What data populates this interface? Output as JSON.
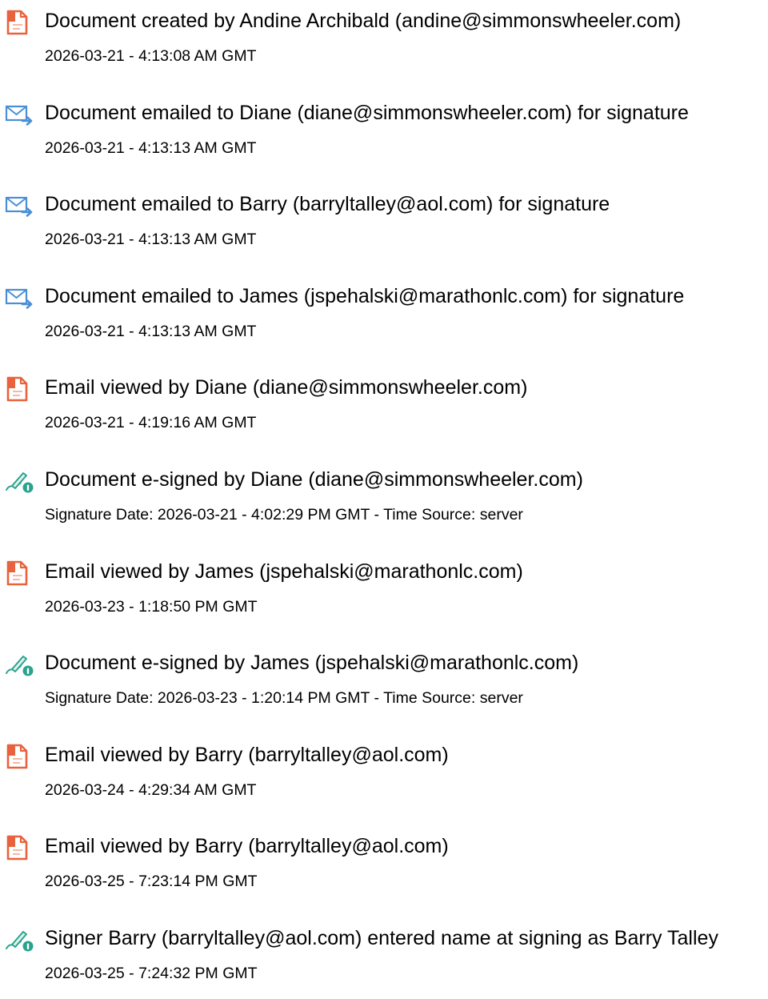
{
  "colors": {
    "document_icon": "#e8623d",
    "email_icon": "#4a8fd6",
    "signature_icon": "#2aa38e",
    "text": "#000000"
  },
  "events": [
    {
      "icon": "document-icon",
      "title": "Document created by Andine Archibald (andine@simmonswheeler.com)",
      "meta": "2026-03-21 - 4:13:08 AM GMT"
    },
    {
      "icon": "email-send-icon",
      "title": "Document emailed to Diane (diane@simmonswheeler.com) for signature",
      "meta": "2026-03-21 - 4:13:13 AM GMT"
    },
    {
      "icon": "email-send-icon",
      "title": "Document emailed to Barry (barryltalley@aol.com) for signature",
      "meta": "2026-03-21 - 4:13:13 AM GMT"
    },
    {
      "icon": "email-send-icon",
      "title": "Document emailed to James (jspehalski@marathonlc.com) for signature",
      "meta": "2026-03-21 - 4:13:13 AM GMT"
    },
    {
      "icon": "document-icon",
      "title": "Email viewed by Diane (diane@simmonswheeler.com)",
      "meta": "2026-03-21 - 4:19:16 AM GMT"
    },
    {
      "icon": "signature-pen-icon",
      "title": "Document e-signed by Diane (diane@simmonswheeler.com)",
      "meta": "Signature Date: 2026-03-21 - 4:02:29 PM GMT - Time Source: server"
    },
    {
      "icon": "document-icon",
      "title": "Email viewed by James (jspehalski@marathonlc.com)",
      "meta": "2026-03-23 - 1:18:50 PM GMT"
    },
    {
      "icon": "signature-pen-icon",
      "title": "Document e-signed by James (jspehalski@marathonlc.com)",
      "meta": "Signature Date: 2026-03-23 - 1:20:14 PM GMT - Time Source: server"
    },
    {
      "icon": "document-icon",
      "title": "Email viewed by Barry (barryltalley@aol.com)",
      "meta": "2026-03-24 - 4:29:34 AM GMT"
    },
    {
      "icon": "document-icon",
      "title": "Email viewed by Barry (barryltalley@aol.com)",
      "meta": "2026-03-25 - 7:23:14 PM GMT"
    },
    {
      "icon": "signature-pen-icon",
      "title": "Signer Barry (barryltalley@aol.com) entered name at signing as Barry Talley",
      "meta": "2026-03-25 - 7:24:32 PM GMT"
    }
  ]
}
